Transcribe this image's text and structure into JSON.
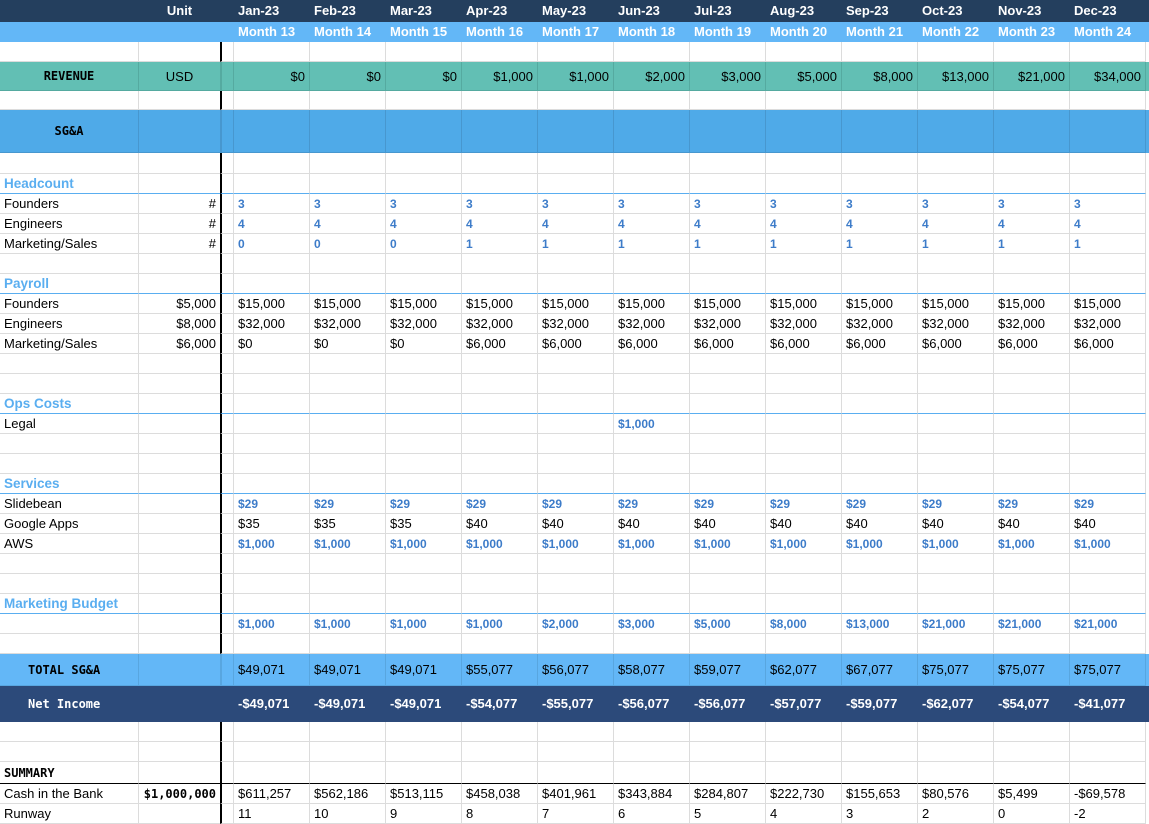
{
  "header": {
    "unit_label": "Unit",
    "months": [
      "Jan-23",
      "Feb-23",
      "Mar-23",
      "Apr-23",
      "May-23",
      "Jun-23",
      "Jul-23",
      "Aug-23",
      "Sep-23",
      "Oct-23",
      "Nov-23",
      "Dec-23"
    ],
    "month_numbers": [
      "Month 13",
      "Month 14",
      "Month 15",
      "Month 16",
      "Month 17",
      "Month 18",
      "Month 19",
      "Month 20",
      "Month 21",
      "Month 22",
      "Month 23",
      "Month 24"
    ]
  },
  "revenue": {
    "label": "REVENUE",
    "unit": "USD",
    "values": [
      "$0",
      "$0",
      "$0",
      "$1,000",
      "$1,000",
      "$2,000",
      "$3,000",
      "$5,000",
      "$8,000",
      "$13,000",
      "$21,000",
      "$34,000"
    ]
  },
  "sga": {
    "label": "SG&A"
  },
  "headcount": {
    "label": "Headcount",
    "rows": [
      {
        "label": "Founders",
        "unit": "#",
        "values": [
          "3",
          "3",
          "3",
          "3",
          "3",
          "3",
          "3",
          "3",
          "3",
          "3",
          "3",
          "3"
        ]
      },
      {
        "label": "Engineers",
        "unit": "#",
        "values": [
          "4",
          "4",
          "4",
          "4",
          "4",
          "4",
          "4",
          "4",
          "4",
          "4",
          "4",
          "4"
        ]
      },
      {
        "label": "Marketing/Sales",
        "unit": "#",
        "values": [
          "0",
          "0",
          "0",
          "1",
          "1",
          "1",
          "1",
          "1",
          "1",
          "1",
          "1",
          "1"
        ]
      }
    ]
  },
  "payroll": {
    "label": "Payroll",
    "rows": [
      {
        "label": "Founders",
        "unit": "$5,000",
        "values": [
          "$15,000",
          "$15,000",
          "$15,000",
          "$15,000",
          "$15,000",
          "$15,000",
          "$15,000",
          "$15,000",
          "$15,000",
          "$15,000",
          "$15,000",
          "$15,000"
        ]
      },
      {
        "label": "Engineers",
        "unit": "$8,000",
        "values": [
          "$32,000",
          "$32,000",
          "$32,000",
          "$32,000",
          "$32,000",
          "$32,000",
          "$32,000",
          "$32,000",
          "$32,000",
          "$32,000",
          "$32,000",
          "$32,000"
        ]
      },
      {
        "label": "Marketing/Sales",
        "unit": "$6,000",
        "values": [
          "$0",
          "$0",
          "$0",
          "$6,000",
          "$6,000",
          "$6,000",
          "$6,000",
          "$6,000",
          "$6,000",
          "$6,000",
          "$6,000",
          "$6,000"
        ]
      }
    ]
  },
  "ops": {
    "label": "Ops Costs",
    "rows": [
      {
        "label": "Legal",
        "unit": "",
        "values": [
          "",
          "",
          "",
          "",
          "",
          "$1,000",
          "",
          "",
          "",
          "",
          "",
          ""
        ]
      }
    ]
  },
  "services": {
    "label": "Services",
    "rows": [
      {
        "label": "Slidebean",
        "unit": "",
        "values": [
          "$29",
          "$29",
          "$29",
          "$29",
          "$29",
          "$29",
          "$29",
          "$29",
          "$29",
          "$29",
          "$29",
          "$29"
        ]
      },
      {
        "label": "Google Apps",
        "unit": "",
        "values": [
          "$35",
          "$35",
          "$35",
          "$40",
          "$40",
          "$40",
          "$40",
          "$40",
          "$40",
          "$40",
          "$40",
          "$40"
        ]
      },
      {
        "label": "AWS",
        "unit": "",
        "values": [
          "$1,000",
          "$1,000",
          "$1,000",
          "$1,000",
          "$1,000",
          "$1,000",
          "$1,000",
          "$1,000",
          "$1,000",
          "$1,000",
          "$1,000",
          "$1,000"
        ]
      }
    ]
  },
  "marketing": {
    "label": "Marketing Budget",
    "rows": [
      {
        "label": "",
        "unit": "",
        "values": [
          "$1,000",
          "$1,000",
          "$1,000",
          "$1,000",
          "$2,000",
          "$3,000",
          "$5,000",
          "$8,000",
          "$13,000",
          "$21,000",
          "$21,000",
          "$21,000"
        ]
      }
    ]
  },
  "total_sga": {
    "label": "TOTAL SG&A",
    "values": [
      "$49,071",
      "$49,071",
      "$49,071",
      "$55,077",
      "$56,077",
      "$58,077",
      "$59,077",
      "$62,077",
      "$67,077",
      "$75,077",
      "$75,077",
      "$75,077"
    ]
  },
  "net_income": {
    "label": "Net Income",
    "values": [
      "-$49,071",
      "-$49,071",
      "-$49,071",
      "-$54,077",
      "-$55,077",
      "-$56,077",
      "-$56,077",
      "-$57,077",
      "-$59,077",
      "-$62,077",
      "-$54,077",
      "-$41,077"
    ]
  },
  "summary": {
    "label": "SUMMARY",
    "cash": {
      "label": "Cash in the Bank",
      "unit": "$1,000,000",
      "values": [
        "$611,257",
        "$562,186",
        "$513,115",
        "$458,038",
        "$401,961",
        "$343,884",
        "$284,807",
        "$222,730",
        "$155,653",
        "$80,576",
        "$5,499",
        "-$69,578"
      ]
    },
    "runway": {
      "label": "Runway",
      "values": [
        "11",
        "10",
        "9",
        "8",
        "7",
        "6",
        "5",
        "4",
        "3",
        "2",
        "0",
        "-2"
      ]
    }
  }
}
